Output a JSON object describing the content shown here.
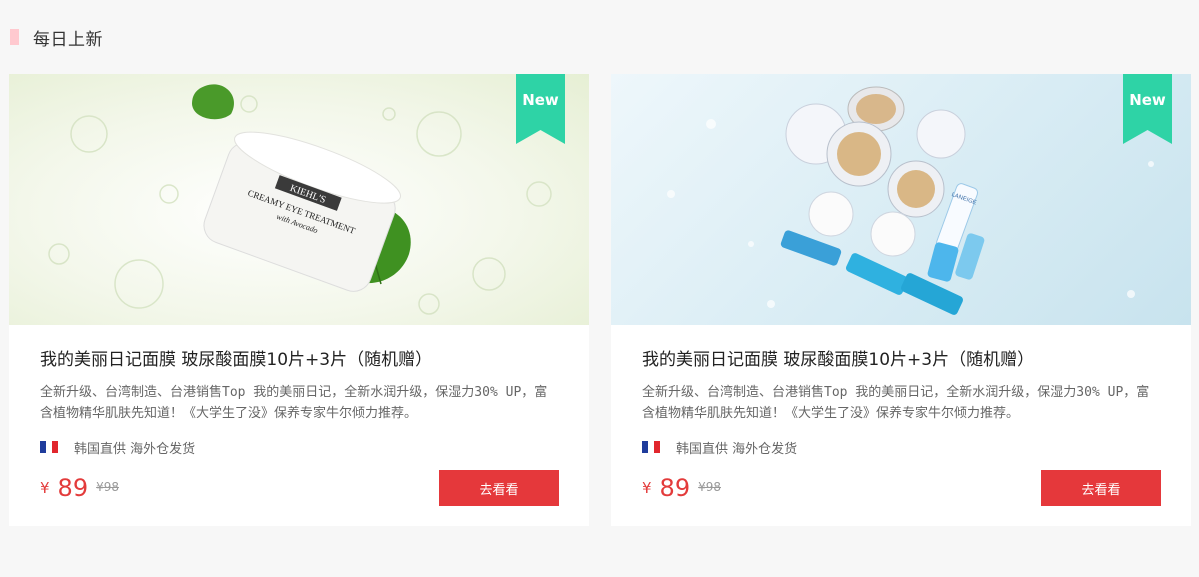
{
  "section": {
    "title": "每日上新"
  },
  "cards": [
    {
      "badge": "New",
      "title": "我的美丽日记面膜 玻尿酸面膜10片+3片（随机赠）",
      "description": "全新升级、台湾制造、台港销售Top 我的美丽日记，全新水润升级，保湿力30% UP，富含植物精华肌肤先知道！《大学生了没》保养专家牛尔倾力推荐。",
      "origin": "韩国直供 海外仓发货",
      "currency": "¥",
      "price": "89",
      "old_price": "¥98",
      "button": "去看看",
      "product_label": "KIEHL'S CREAMY EYE TREATMENT with Avocado"
    },
    {
      "badge": "New",
      "title": "我的美丽日记面膜 玻尿酸面膜10片+3片（随机赠）",
      "description": "全新升级、台湾制造、台港销售Top 我的美丽日记，全新水润升级，保湿力30% UP，富含植物精华肌肤先知道！《大学生了没》保养专家牛尔倾力推荐。",
      "origin": "韩国直供 海外仓发货",
      "currency": "¥",
      "price": "89",
      "old_price": "¥98",
      "button": "去看看",
      "product_label": "LANEIGE"
    }
  ],
  "colors": {
    "accent_red": "#e5383b",
    "badge_green": "#2ed3a6",
    "section_marker": "#ffc9cf"
  }
}
